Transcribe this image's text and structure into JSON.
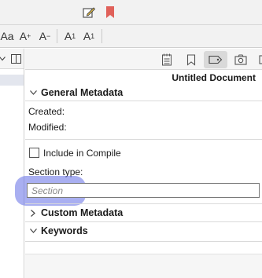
{
  "toolbar": {
    "format_buttons": [
      {
        "label": "Aa",
        "name": "font-button"
      },
      {
        "label": "A",
        "sup": "+",
        "name": "font-bigger-button"
      },
      {
        "label": "A",
        "sup": "−",
        "name": "font-smaller-button"
      },
      {
        "label": "A",
        "sup": "1",
        "name": "superscript-button"
      },
      {
        "label": "A",
        "sub": "1",
        "name": "subscript-button"
      }
    ]
  },
  "inspector": {
    "doc_title": "Untitled Document",
    "general_metadata": "General Metadata",
    "created_label": "Created:",
    "modified_label": "Modified:",
    "include_in_compile": "Include in Compile",
    "section_type_label": "Section type:",
    "section_type_placeholder": "Section",
    "custom_metadata": "Custom Metadata",
    "keywords": "Keywords",
    "active_tab": "metadata"
  },
  "colors": {
    "toolbar_bg": "#f2f2f2",
    "flag_red": "#e0615a",
    "focus_highlight": "#636ee6"
  }
}
